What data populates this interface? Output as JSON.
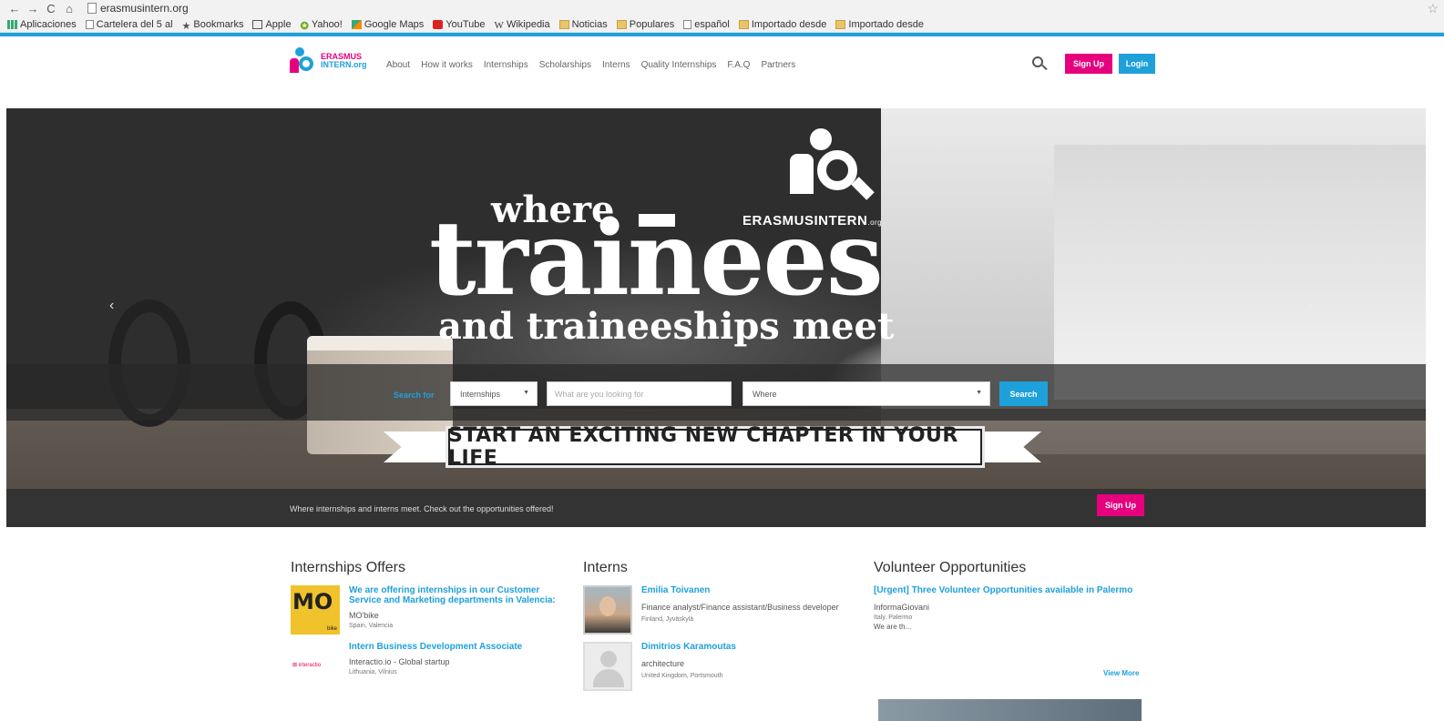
{
  "browser": {
    "url": "erasmusintern.org",
    "bookmarks": [
      "Aplicaciones",
      "Cartelera del 5 al",
      "Bookmarks",
      "Apple",
      "Yahoo!",
      "Google Maps",
      "YouTube",
      "Wikipedia",
      "Noticias",
      "Populares",
      "español",
      "Importado desde",
      "Importado desde"
    ]
  },
  "header": {
    "logo_line1": "ERASMUS",
    "logo_line2": "INTERN.org",
    "nav": [
      "About",
      "How it works",
      "Internships",
      "Scholarships",
      "Interns",
      "Quality Internships",
      "F.A.Q",
      "Partners"
    ],
    "signup_label": "Sign Up",
    "login_label": "Login"
  },
  "hero": {
    "line_where": "where",
    "line_trainees": "trainees",
    "line_and": "and traineeships meet",
    "brand": "ERASMUSINTERN",
    "brand_suffix": ".org",
    "prev_arrow": "‹",
    "next_arrow": "›"
  },
  "search": {
    "label": "Search for",
    "type_value": "Internships",
    "what_placeholder": "What are you looking for",
    "where_value": "Where",
    "button": "Search"
  },
  "banner": {
    "text": "START AN EXCITING NEW CHAPTER IN YOUR LIFE"
  },
  "cta": {
    "text": "Where internships and interns meet. Check out the opportunities offered!",
    "button": "Sign Up"
  },
  "offers": {
    "heading": "Internships Offers",
    "items": [
      {
        "title": "We are offering internships in our Customer Service and Marketing departments in Valencia:",
        "org": "MO'bike",
        "location": "Spain, Valencia"
      },
      {
        "title": "Intern Business Development Associate",
        "org": "Interactio.io - Global startup",
        "location": "Lithuania, Vilnius"
      }
    ]
  },
  "interns": {
    "heading": "Interns",
    "items": [
      {
        "name": "Emilia Toivanen",
        "desc": "Finance analyst/Finance assistant/Business developer",
        "location": "Finland, Jyväskylä"
      },
      {
        "name": "Dimitrios Karamoutas",
        "desc": "architecture",
        "location": "United Kingdom, Portsmouth"
      }
    ]
  },
  "volunteer": {
    "heading": "Volunteer Opportunities",
    "title": "[Urgent] Three Volunteer Opportunities available in Palermo",
    "org": "InformaGiovani",
    "location": "Italy, Palermo",
    "desc": "We are th...",
    "view_more": "View More"
  },
  "colors": {
    "brand_blue": "#1ea0db",
    "brand_pink": "#e6007e",
    "dark_band": "#333333"
  }
}
